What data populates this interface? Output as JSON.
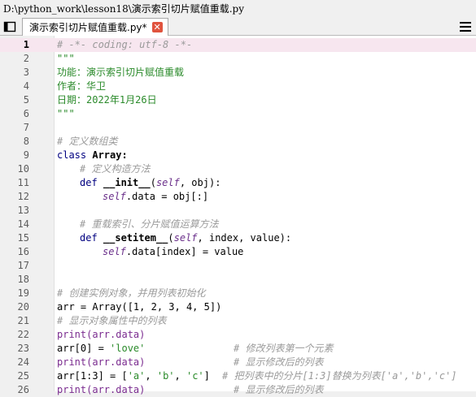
{
  "window": {
    "title": "D:\\python_work\\lesson18\\演示索引切片赋值重载.py"
  },
  "tab": {
    "label": "演示索引切片赋值重载.py*",
    "close_icon": "close-icon"
  },
  "editor": {
    "line_numbers": [
      "1",
      "2",
      "3",
      "4",
      "5",
      "6",
      "7",
      "8",
      "9",
      "10",
      "11",
      "12",
      "13",
      "14",
      "15",
      "16",
      "17",
      "18",
      "19",
      "20",
      "21",
      "22",
      "23",
      "24",
      "25",
      "26"
    ],
    "lines": {
      "l1": "# -*- coding: utf-8 -*-",
      "l2": "\"\"\"",
      "l3": "功能：演示索引切片赋值重载",
      "l4": "作者：华卫",
      "l5": "日期：2022年1月26日",
      "l6": "\"\"\"",
      "l8": "# 定义数组类",
      "l9_kw": "class ",
      "l9_name": "Array:",
      "l10": "# 定义构造方法",
      "l11_kw": "def ",
      "l11_name": "__init__",
      "l11_open": "(",
      "l11_self": "self",
      "l11_rest": ", obj):",
      "l12_self": "self",
      "l12_rest": ".data = obj[:]",
      "l14": "# 重载索引、分片赋值运算方法",
      "l15_kw": "def ",
      "l15_name": "__setitem__",
      "l15_open": "(",
      "l15_self": "self",
      "l15_rest": ", index, value):",
      "l16_self": "self",
      "l16_rest": ".data[index] = value",
      "l19": "# 创建实例对象，并用列表初始化",
      "l20": "arr = Array([1, 2, 3, 4, 5])",
      "l21": "# 显示对象属性中的列表",
      "l22": "print(arr.data)",
      "l23_code": "arr[0] = ",
      "l23_str": "'love'",
      "l23_cm": "# 修改列表第一个元素",
      "l24_code": "print(arr.data)",
      "l24_cm": "# 显示修改后的列表",
      "l25_code": "arr[1:3] = [",
      "l25_s1": "'a'",
      "l25_c1": ", ",
      "l25_s2": "'b'",
      "l25_c2": ", ",
      "l25_s3": "'c'",
      "l25_c3": "]",
      "l25_cm": "# 把列表中的分片[1:3]替换为列表['a','b','c']",
      "l26_code": "print(arr.data)",
      "l26_cm": "# 显示修改后的列表"
    }
  },
  "colors": {
    "comment": "#9a9a9a",
    "string": "#2a8a2a",
    "current_line": "#f7e6ef",
    "close": "#e0533e"
  }
}
